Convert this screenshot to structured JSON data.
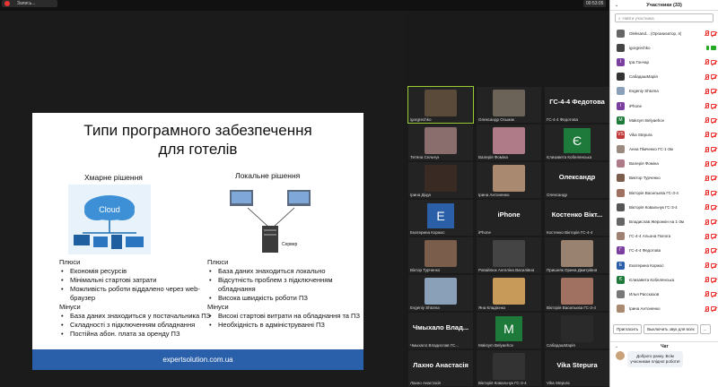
{
  "topbar": {
    "rec_label": "Запись...",
    "timer": "00:53:05"
  },
  "slide": {
    "title_line1": "Типи програмного забезпечення",
    "title_line2": "для готелів",
    "cloud_title": "Хмарне рішення",
    "local_title": "Локальне рішення",
    "cloud_label": "Cloud",
    "server_label": "Сервер",
    "cloud_pros_title": "Плюси",
    "cloud_pros": [
      "Економія ресурсів",
      "Мінімальні стартові затрати",
      "Можливість роботи віддалено через web-браузер"
    ],
    "cloud_cons_title": "Мінуси",
    "cloud_cons": [
      "База даних знаходиться у постачальника ПЗ",
      "Складності з підключенням обладнання",
      "Постійна абон. плата за оренду ПЗ"
    ],
    "local_pros_title": "Плюси",
    "local_pros": [
      "База даних знаходиться локально",
      "Відсутність проблем з підключенням обладнання",
      "Висока швидкість роботи ПЗ"
    ],
    "local_cons_title": "Мінуси",
    "local_cons": [
      "Високі стартові витрати на обладнання та ПЗ",
      "Необхідність в адмініструванні ПЗ"
    ],
    "footer": "expertsolution.com.ua"
  },
  "tiles": [
    {
      "name": "igorgrechko",
      "big": "",
      "avatar": "",
      "color": "#5a4a3a"
    },
    {
      "name": "Олександр Осьмак",
      "big": "",
      "avatar": "",
      "color": "#6b6258"
    },
    {
      "name": "ГС-4-4 Федотова",
      "big": "ГС-4-4 Федотова",
      "avatar": "",
      "color": ""
    },
    {
      "name": "Тетяна Сельчук",
      "big": "",
      "avatar": "",
      "color": "#8a6e6e"
    },
    {
      "name": "Валерія Фоміна",
      "big": "",
      "avatar": "",
      "color": "#b07b88"
    },
    {
      "name": "Єлизавета Кобелянська",
      "big": "",
      "avatar": "Є",
      "color": "#1e7a3a"
    },
    {
      "name": "Ірина Діцук",
      "big": "",
      "avatar": "",
      "color": "#3a2a24"
    },
    {
      "name": "Ірина Антоненко",
      "big": "",
      "avatar": "",
      "color": "#a98a70"
    },
    {
      "name": "Олександр",
      "big": "Олександр",
      "avatar": "",
      "color": ""
    },
    {
      "name": "Екатерина Коржос",
      "big": "",
      "avatar": "Е",
      "color": "#2b5fa8"
    },
    {
      "name": "iPhone",
      "big": "iPhone",
      "avatar": "",
      "color": ""
    },
    {
      "name": "Костенко Вікторія ГС-4-4",
      "big": "Костенко Вікт...",
      "avatar": "",
      "color": ""
    },
    {
      "name": "Віктор Турченко",
      "big": "",
      "avatar": "",
      "color": "#7a5d4b"
    },
    {
      "name": "Ровайлюк Ангеліна Василівна",
      "big": "",
      "avatar": "",
      "color": "#444"
    },
    {
      "name": "Пришняк Орина Дмитрівна",
      "big": "",
      "avatar": "",
      "color": "#9a8270"
    },
    {
      "name": "Evgeniy Shtoma",
      "big": "",
      "avatar": "",
      "color": "#8aa0b8"
    },
    {
      "name": "Яна Кладієнко",
      "big": "",
      "avatar": "",
      "color": "#c89a5a"
    },
    {
      "name": "Вікторія Васильєва ГС-3-4",
      "big": "",
      "avatar": "",
      "color": "#a07060"
    },
    {
      "name": "Чмыхало Владислав ГС...",
      "big": "Чмыхало Влад...",
      "avatar": "",
      "color": ""
    },
    {
      "name": "Maksym Belyaehov",
      "big": "",
      "avatar": "M",
      "color": "#1e7a3a"
    },
    {
      "name": "СабадашМарія",
      "big": "",
      "avatar": "",
      "color": "#2a2a2a"
    },
    {
      "name": "Лахно Анастасія",
      "big": "Лахно Анастасія",
      "avatar": "",
      "color": ""
    },
    {
      "name": "Вікторія Ковальчук ГС-3-4",
      "big": "",
      "avatar": "",
      "color": "#333"
    },
    {
      "name": "Vika Stepura",
      "big": "Vika Stepura",
      "avatar": "",
      "color": ""
    }
  ],
  "panel": {
    "title": "Участники (33)",
    "search_placeholder": "Найти участника",
    "participants": [
      {
        "name": "Oleksand... (Организатор, я)",
        "avatar": "",
        "color": "#666",
        "cam": "off",
        "mic": "off"
      },
      {
        "name": "igorgrechko",
        "avatar": "",
        "color": "#444",
        "cam": "on",
        "mic": "on"
      },
      {
        "name": "Іра Гончар",
        "avatar": "І",
        "color": "#7b3fa0",
        "cam": "off",
        "mic": "off"
      },
      {
        "name": "СабадашМарія",
        "avatar": "",
        "color": "#333",
        "cam": "off",
        "mic": "off"
      },
      {
        "name": "Evgeniy Shtoma",
        "avatar": "",
        "color": "#8aa0b8",
        "cam": "off",
        "mic": "off"
      },
      {
        "name": "iPhone",
        "avatar": "i",
        "color": "#7b3fa0",
        "cam": "off",
        "mic": "off"
      },
      {
        "name": "Maksym Belyaehov",
        "avatar": "M",
        "color": "#1e7a3a",
        "cam": "off",
        "mic": "off"
      },
      {
        "name": "Vika Stepura",
        "avatar": "VS",
        "color": "#c23b3b",
        "cam": "off",
        "mic": "off"
      },
      {
        "name": "Анна Пімченко ГС-1-3м",
        "avatar": "",
        "color": "#9a8a80",
        "cam": "off",
        "mic": "off"
      },
      {
        "name": "Валерія Фоміна",
        "avatar": "",
        "color": "#b07b88",
        "cam": "off",
        "mic": "off"
      },
      {
        "name": "Виктор Турченко",
        "avatar": "",
        "color": "#7a5d4b",
        "cam": "off",
        "mic": "off"
      },
      {
        "name": "Вікторія Васильєва ГС-3-4",
        "avatar": "",
        "color": "#a07060",
        "cam": "off",
        "mic": "off"
      },
      {
        "name": "Вікторія Ковальчук ГС-3-4",
        "avatar": "",
        "color": "#555",
        "cam": "off",
        "mic": "off"
      },
      {
        "name": "Владислав Жеронкін на 1-3м",
        "avatar": "",
        "color": "#666",
        "cam": "off",
        "mic": "off"
      },
      {
        "name": "ГС-4-4 Альона Попога",
        "avatar": "",
        "color": "#a08070",
        "cam": "off",
        "mic": "off"
      },
      {
        "name": "ГС-4-4 Федотова",
        "avatar": "Г",
        "color": "#7b3fa0",
        "cam": "off",
        "mic": "off"
      },
      {
        "name": "Екатерина Коржос",
        "avatar": "Е",
        "color": "#2b5fa8",
        "cam": "off",
        "mic": "off"
      },
      {
        "name": "Єлизавета Кобелянська",
        "avatar": "Є",
        "color": "#1e7a3a",
        "cam": "off",
        "mic": "off"
      },
      {
        "name": "Илья Рассказов",
        "avatar": "",
        "color": "#777",
        "cam": "off",
        "mic": "off"
      },
      {
        "name": "Ірина Антоненко",
        "avatar": "",
        "color": "#a98a70",
        "cam": "off",
        "mic": "off"
      }
    ],
    "invite_btn": "Пригласить",
    "mute_all_btn": "Выключить звук для всех",
    "more_btn": "...",
    "chat_title": "Чат",
    "chat_message": "Доброго ранку. Всім учасникам плідної роботи!"
  }
}
